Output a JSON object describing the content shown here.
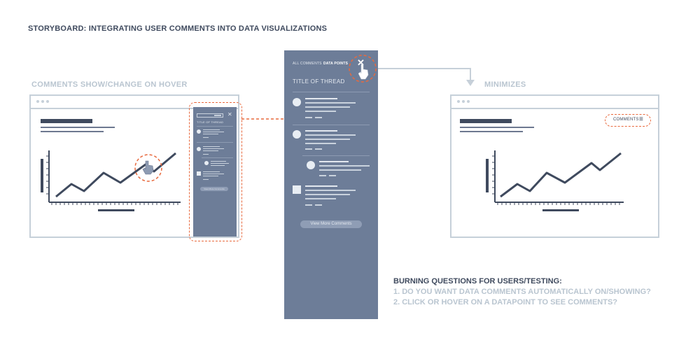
{
  "title": "STORYBOARD: INTEGRATING USER COMMENTS INTO DATA VISUALIZATIONS",
  "captions": {
    "left": "COMMENTS SHOW/CHANGE ON HOVER",
    "right": "MINIMIZES"
  },
  "panel": {
    "tab_all": "ALL COMMENTS",
    "tab_data": "DATA POINTS",
    "thread_title": "TITLE OF THREAD",
    "view_more": "View More Comments",
    "close_glyph": "✕"
  },
  "mini_panel": {
    "thread_title": "TITLE OF THREAD",
    "view_more": "View More Comments",
    "close_glyph": "✕"
  },
  "right_window": {
    "comments_label": "COMMENTS",
    "menu_glyph": "≡"
  },
  "questions": {
    "heading": "BURNING QUESTIONS FOR USERS/TESTING:",
    "items": [
      "1. DO YOU WANT DATA COMMENTS AUTOMATICALLY ON/SHOWING?",
      "2. CLICK OR HOVER ON A DATAPOINT TO SEE COMMENTS?"
    ]
  },
  "colors": {
    "accent": "#e8693d",
    "dark": "#3f4a5e",
    "panel": "#6d7d98",
    "frame": "#c6d0d9"
  },
  "icons": [
    "cursor-hand-icon",
    "close-icon",
    "menu-icon",
    "avatar-icon"
  ]
}
